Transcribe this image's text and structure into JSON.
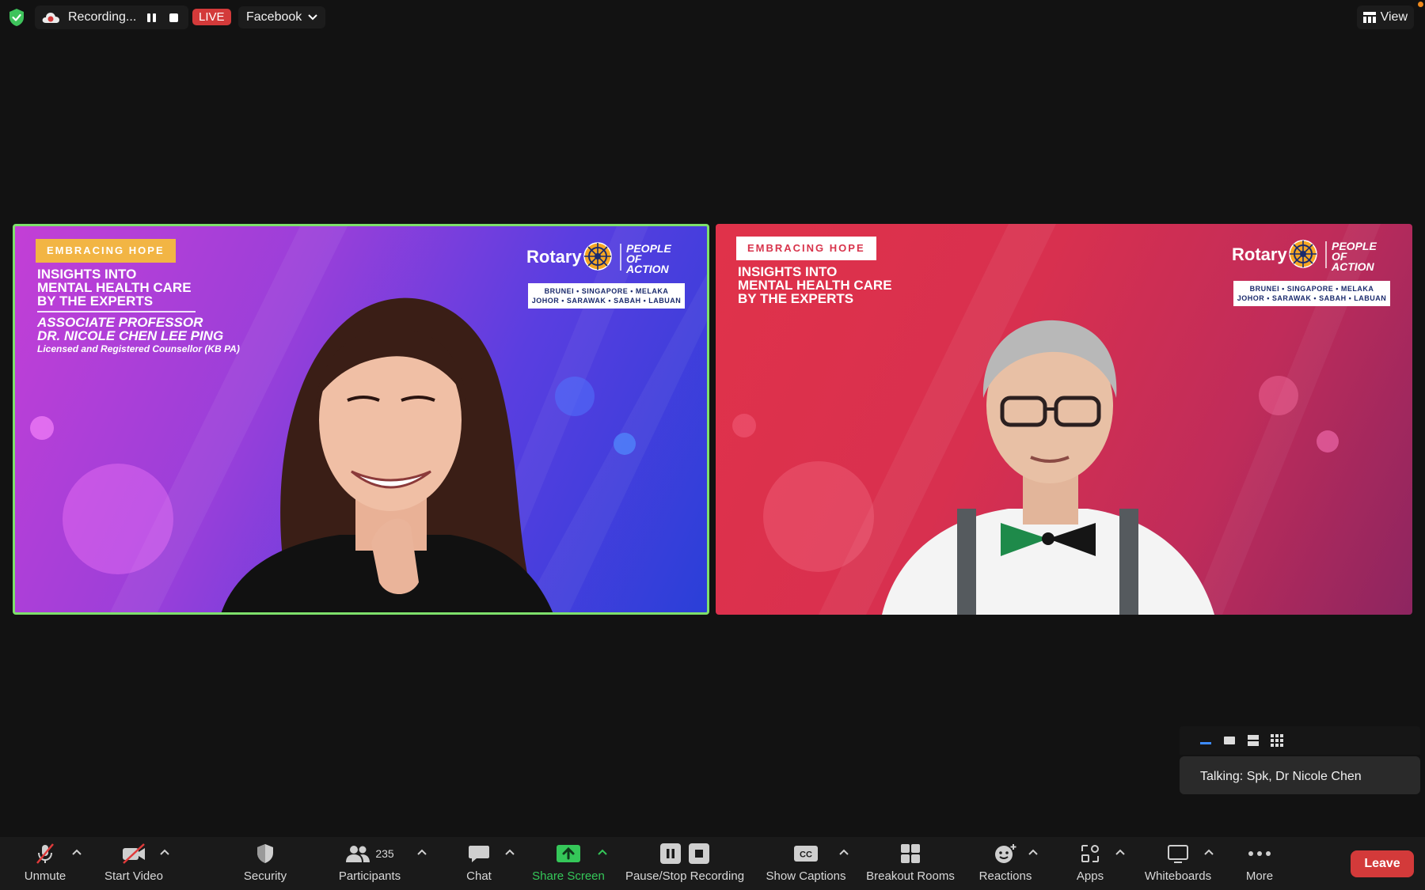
{
  "topbar": {
    "recording_label": "Recording...",
    "live_label": "LIVE",
    "stream_target": "Facebook",
    "view_label": "View"
  },
  "tiles": {
    "left": {
      "tag": "EMBRACING HOPE",
      "headline": [
        "INSIGHTS INTO",
        "MENTAL HEALTH CARE",
        "BY THE EXPERTS"
      ],
      "speaker": [
        "ASSOCIATE PROFESSOR",
        "DR. NICOLE CHEN LEE PING"
      ],
      "credential": "Licensed and Registered Counsellor (KB PA)",
      "brand": "Rotary",
      "slogan": [
        "PEOPLE OF",
        "ACTION"
      ],
      "regions": [
        "BRUNEI • SINGAPORE • MELAKA",
        "JOHOR • SARAWAK • SABAH • LABUAN"
      ]
    },
    "right": {
      "tag": "EMBRACING HOPE",
      "headline": [
        "INSIGHTS INTO",
        "MENTAL HEALTH CARE",
        "BY THE EXPERTS"
      ],
      "brand": "Rotary",
      "slogan": [
        "PEOPLE OF",
        "ACTION"
      ],
      "regions": [
        "BRUNEI • SINGAPORE • MELAKA",
        "JOHOR • SARAWAK • SABAH • LABUAN"
      ]
    }
  },
  "talking": "Talking: Spk, Dr Nicole Chen",
  "toolbar": {
    "unmute": "Unmute",
    "start_video": "Start Video",
    "security": "Security",
    "participants": "Participants",
    "participant_count": "235",
    "chat": "Chat",
    "share_screen": "Share Screen",
    "pause_stop": "Pause/Stop Recording",
    "show_captions": "Show Captions",
    "cc": "CC",
    "breakout": "Breakout Rooms",
    "reactions": "Reactions",
    "apps": "Apps",
    "whiteboards": "Whiteboards",
    "more": "More",
    "leave": "Leave"
  },
  "colors": {
    "active_speaker_border": "#7ee06b",
    "live_red": "#d33a3a",
    "share_green": "#35c759",
    "record_orange": "#f08a1c"
  }
}
